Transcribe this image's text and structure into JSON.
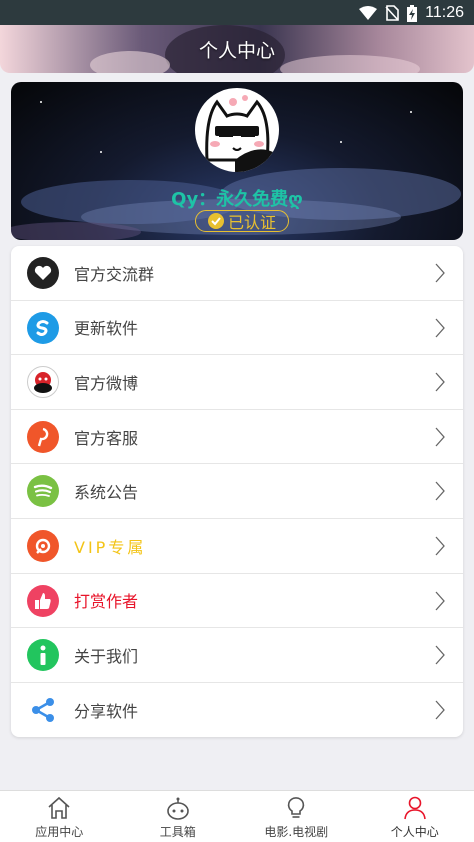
{
  "status_bar": {
    "time": "11:26"
  },
  "header": {
    "title": "个人中心"
  },
  "profile": {
    "name": "Qy：永久免费ღ",
    "badge": "已认证"
  },
  "menu": [
    {
      "label": "官方交流群",
      "icon": "heart-icon",
      "color": "#222222",
      "label_color": "#444444"
    },
    {
      "label": "更新软件",
      "icon": "refresh-s-icon",
      "color": "#1e9be6",
      "label_color": "#444444"
    },
    {
      "label": "官方微博",
      "icon": "weibo-avatar-icon",
      "color": "#ffffff",
      "label_color": "#444444"
    },
    {
      "label": "官方客服",
      "icon": "service-p-icon",
      "color": "#f0562a",
      "label_color": "#444444"
    },
    {
      "label": "系统公告",
      "icon": "announcement-icon",
      "color": "#7ac143",
      "label_color": "#444444"
    },
    {
      "label": "VIP专属",
      "icon": "vip-icon",
      "color": "#f0562a",
      "label_color": "#f3c417"
    },
    {
      "label": "打赏作者",
      "icon": "thumbs-up-icon",
      "color": "#ef4262",
      "label_color": "#e8142a"
    },
    {
      "label": "关于我们",
      "icon": "info-icon",
      "color": "#22c55e",
      "label_color": "#444444"
    },
    {
      "label": "分享软件",
      "icon": "share-icon",
      "color": "#3b8fe8",
      "label_color": "#444444"
    }
  ],
  "tabs": [
    {
      "label": "应用中心",
      "icon": "home-icon",
      "active": false
    },
    {
      "label": "工具箱",
      "icon": "robot-icon",
      "active": false
    },
    {
      "label": "电影.电视剧",
      "icon": "bulb-icon",
      "active": false
    },
    {
      "label": "个人中心",
      "icon": "person-icon",
      "active": true
    }
  ],
  "colors": {
    "accent_active": "#e8142a",
    "verified": "#e8c030",
    "name": "#1ec3a6"
  }
}
